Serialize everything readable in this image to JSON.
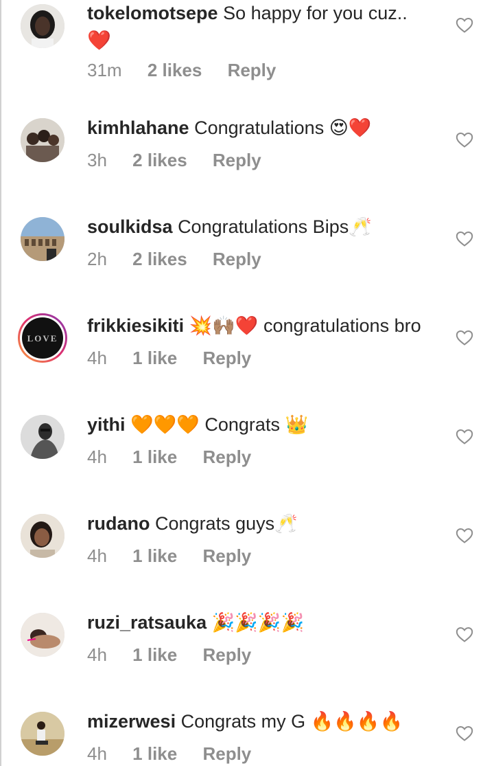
{
  "comments": [
    {
      "username": "tokelomotsepe",
      "text": "So happy for you cuz..",
      "emoji_line": "❤️",
      "time": "31m",
      "likes": "2 likes",
      "reply": "Reply"
    },
    {
      "username": "kimhlahane",
      "text": "Congratulations 😍❤️",
      "time": "3h",
      "likes": "2 likes",
      "reply": "Reply"
    },
    {
      "username": "soulkidsa",
      "text": "Congratulations Bips🥂",
      "time": "2h",
      "likes": "2 likes",
      "reply": "Reply"
    },
    {
      "username": "frikkiesikiti",
      "text": "💥🙌🏽❤️ congratulations bro",
      "avatar_text": "LOVE",
      "time": "4h",
      "likes": "1 like",
      "reply": "Reply"
    },
    {
      "username": "yithi",
      "text": "🧡🧡🧡 Congrats 👑",
      "time": "4h",
      "likes": "1 like",
      "reply": "Reply"
    },
    {
      "username": "rudano",
      "text": "Congrats guys🥂",
      "time": "4h",
      "likes": "1 like",
      "reply": "Reply"
    },
    {
      "username": "ruzi_ratsauka",
      "text": "🎉🎉🎉🎉",
      "time": "4h",
      "likes": "1 like",
      "reply": "Reply"
    },
    {
      "username": "mizerwesi",
      "text": "Congrats my G 🔥🔥🔥🔥",
      "time": "4h",
      "likes": "1 like",
      "reply": "Reply"
    }
  ],
  "icons": {
    "like": "heart-outline-icon"
  },
  "colors": {
    "text": "#262626",
    "meta": "#8e8e8e",
    "heart_stroke": "#8e8e8e"
  }
}
